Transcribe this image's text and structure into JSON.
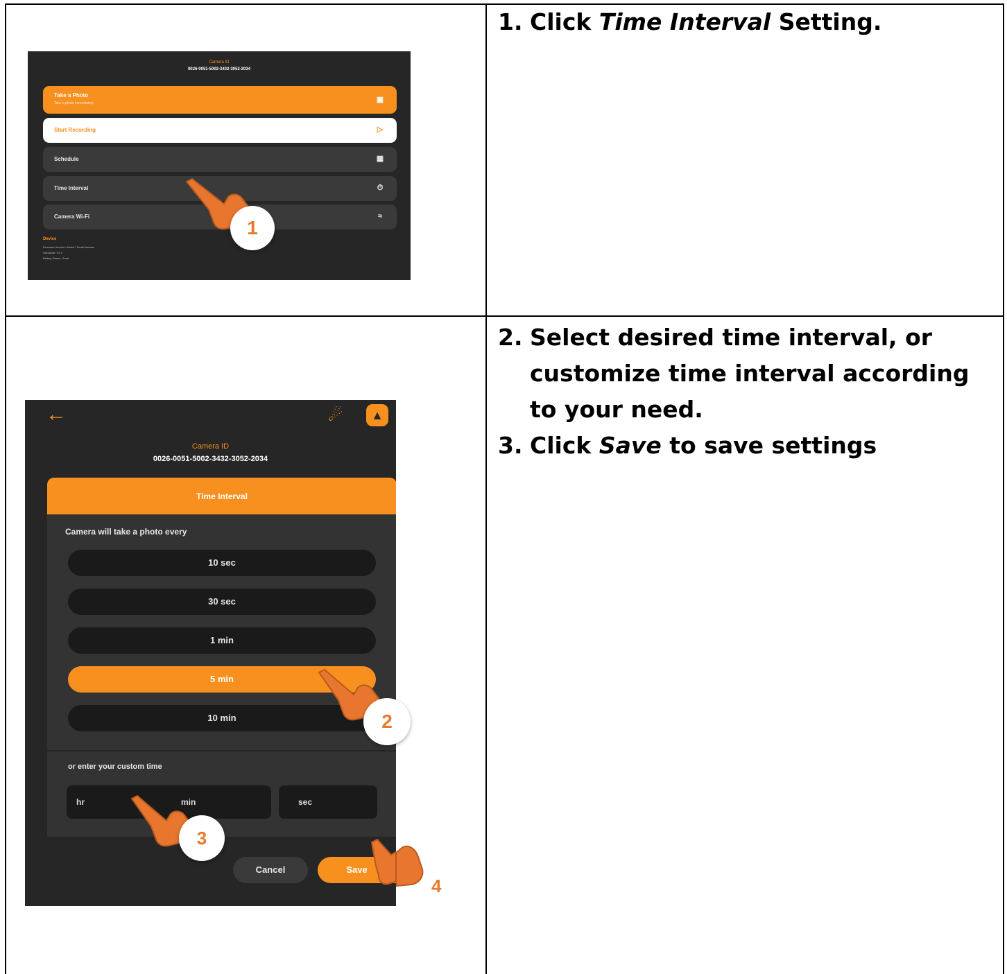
{
  "steps": {
    "step1": {
      "number": "1.",
      "pre": "Click ",
      "em": "Time Interval",
      "post": " Setting."
    },
    "step2": {
      "number": "2.",
      "text": "Select desired time interval, or customize time interval according to your need."
    },
    "step3": {
      "number": "3.",
      "pre": "Click ",
      "em": "Save",
      "post": " to save settings"
    }
  },
  "screen1": {
    "camera_label": "Camera ID",
    "camera_id": "0026-0051-5002-3432-3052-2034",
    "menu": [
      {
        "label": "Take a Photo",
        "sublabel": "Take a photo immediately"
      },
      {
        "label": "Start Recording"
      },
      {
        "label": "Schedule"
      },
      {
        "label": "Time Interval"
      },
      {
        "label": "Camera Wi-Fi"
      }
    ],
    "footer_title": "Device",
    "footer_lines": [
      "Firmware Version / Model / Serial Number",
      "Hardware: V1.0",
      "Battery Status: Good"
    ],
    "badge": "1"
  },
  "screen2": {
    "camera_label": "Camera ID",
    "camera_id": "0026-0051-5002-3432-3052-2034",
    "dialog_title": "Time Interval",
    "prompt": "Camera will take a photo every",
    "options": [
      "10 sec",
      "30 sec",
      "1 min",
      "5 min",
      "10 min"
    ],
    "selected_index": 3,
    "custom_label": "or enter your custom time",
    "fields": {
      "hr": "hr",
      "min": "min",
      "sec": "sec"
    },
    "cancel": "Cancel",
    "save": "Save",
    "badges": [
      "2",
      "3",
      "4"
    ]
  },
  "colors": {
    "accent": "#f7901e",
    "panel": "#262626",
    "row": "#3a3a3a",
    "option": "#1a1a1a"
  }
}
